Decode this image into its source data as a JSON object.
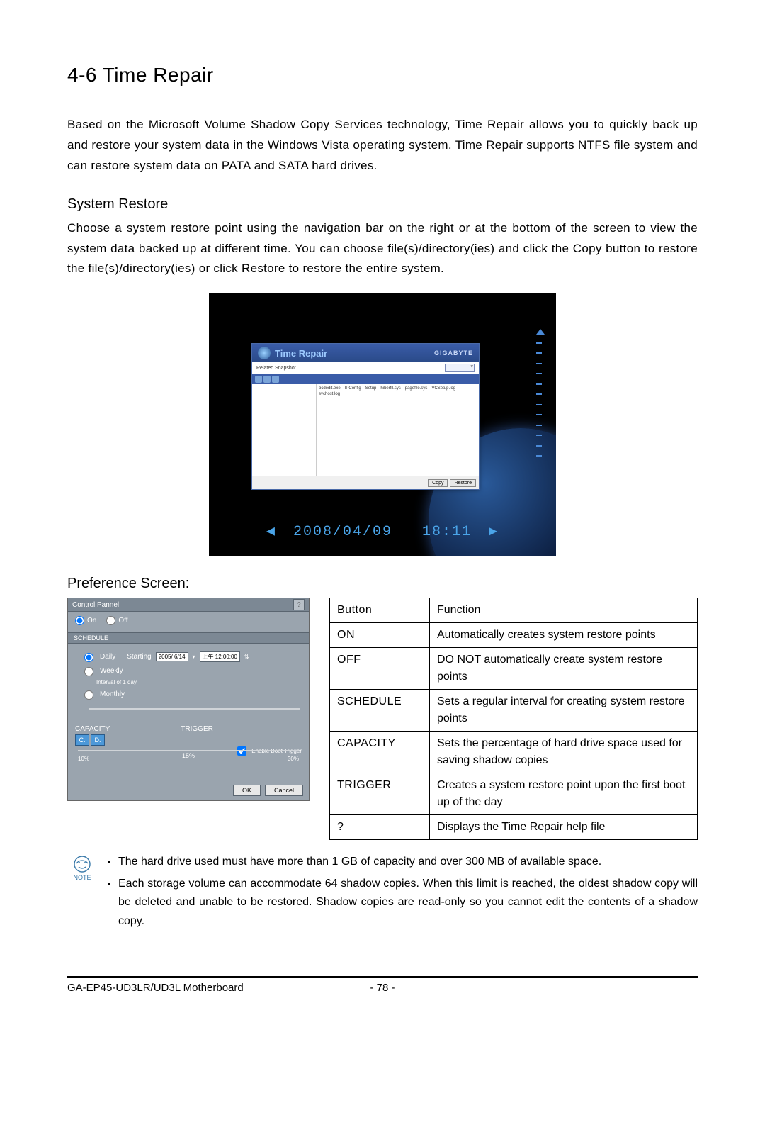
{
  "heading": "4-6    Time Repair",
  "intro": "Based on the Microsoft Volume Shadow Copy Services technology, Time Repair allows you to quickly back up and restore your system data in the Windows Vista operating system. Time Repair supports NTFS file system and can restore system data on PATA and SATA hard drives.",
  "sysrestore_title": "System Restore",
  "sysrestore_body": "Choose a system restore point using the navigation bar on the right or at the bottom of the screen to view the system data backed up at different time. You can choose file(s)/directory(ies) and click the Copy button to restore the file(s)/directory(ies) or click Restore to restore the entire system.",
  "screenshot1": {
    "title": "Time Repair",
    "brand": "GIGABYTE",
    "sub": "Related Snapshot",
    "files": [
      "bcdedit.exe",
      "IPConfig",
      "Setup",
      "hiberfil.sys",
      "pagefile.sys",
      "VCSetup.log",
      "svchost.log"
    ],
    "copy": "Copy",
    "restore": "Restore",
    "timestamp_date": "2008/04/09",
    "timestamp_time": "18:11"
  },
  "pref_title": "Preference Screen:",
  "pref": {
    "panel": "Control Pannel",
    "help": "?",
    "on": "On",
    "off": "Off",
    "schedule": "SCHEDULE",
    "daily": "Daily",
    "starting": "Starting",
    "date": "2005/ 6/14",
    "time": "上午 12:00:00",
    "weekly": "Weekly",
    "interval": "Interval of 1   day",
    "monthly": "Monthly",
    "capacity": "CAPACITY",
    "trigger": "TRIGGER",
    "drives_c": "C:",
    "drives_d": "D:",
    "enable_boot": "Enable Boot Trigger",
    "mark_low": "10%",
    "mark_high": "30%",
    "cap_val": "15%",
    "ok": "OK",
    "cancel": "Cancel"
  },
  "table": {
    "h1": "Button",
    "h2": "Function",
    "r1a": "ON",
    "r1b": "Automatically creates system restore points",
    "r2a": "OFF",
    "r2b": "DO NOT automatically create system restore points",
    "r3a": "SCHEDULE",
    "r3b": "Sets a regular interval for creating system restore points",
    "r4a": "CAPACITY",
    "r4b": "Sets the percentage of hard drive space used for saving shadow copies",
    "r5a": "TRIGGER",
    "r5b": "Creates a system restore point upon the first boot up of the day",
    "r6a": "?",
    "r6b": "Displays the Time Repair help file"
  },
  "note_label": "NOTE",
  "notes": [
    "The hard drive used must have more than 1 GB of capacity and over 300 MB of available space.",
    "Each storage volume can accommodate 64 shadow copies. When this limit is reached, the oldest shadow copy will be deleted and unable to be restored. Shadow copies are read-only so you cannot edit the contents of a shadow copy."
  ],
  "footer_model": "GA-EP45-UD3LR/UD3L Motherboard",
  "footer_page": "- 78 -"
}
